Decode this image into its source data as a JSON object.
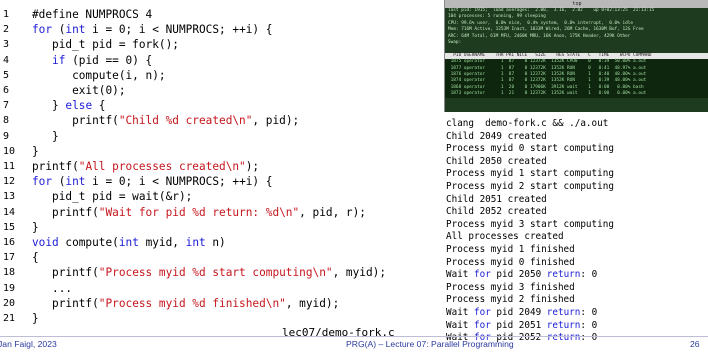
{
  "code": {
    "lines": [
      {
        "n": "1",
        "html": "#define NUMPROCS 4"
      },
      {
        "n": "2",
        "html": "<span class='kw'>for</span> (<span class='kw'>int</span> i = 0; i < NUMPROCS; ++i) {"
      },
      {
        "n": "3",
        "html": "   pid_t pid = fork();"
      },
      {
        "n": "4",
        "html": "   <span class='kw'>if</span> (pid == 0) {"
      },
      {
        "n": "5",
        "html": "      compute(i, n);"
      },
      {
        "n": "6",
        "html": "      exit(0);"
      },
      {
        "n": "7",
        "html": "   } <span class='kw'>else</span> {"
      },
      {
        "n": "8",
        "html": "      printf(<span class='str'>\"Child %d created\\n\"</span>, pid);"
      },
      {
        "n": "9",
        "html": "   }"
      },
      {
        "n": "10",
        "html": "}"
      },
      {
        "n": "11",
        "html": "printf(<span class='str'>\"All processes created\\n\"</span>);"
      },
      {
        "n": "12",
        "html": "<span class='kw'>for</span> (<span class='kw'>int</span> i = 0; i < NUMPROCS; ++i) {"
      },
      {
        "n": "13",
        "html": "   pid_t pid = wait(&r);"
      },
      {
        "n": "14",
        "html": "   printf(<span class='str'>\"Wait for pid %d return: %d\\n\"</span>, pid, r);"
      },
      {
        "n": "15",
        "html": "}"
      },
      {
        "n": "16",
        "html": "<span class='kw'>void</span> compute(<span class='kw'>int</span> myid, <span class='kw'>int</span> n)"
      },
      {
        "n": "17",
        "html": "{"
      },
      {
        "n": "18",
        "html": "   printf(<span class='str'>\"Process myid %d start computing\\n\"</span>, myid);"
      },
      {
        "n": "19",
        "html": "   ..."
      },
      {
        "n": "20",
        "html": "   printf(<span class='str'>\"Process myid %d finished\\n\"</span>, myid);"
      },
      {
        "n": "21",
        "html": "}"
      }
    ],
    "filename": "lec07/demo-fork.c"
  },
  "top_screenshot": {
    "titlebar": "top",
    "lines": [
      "last pid: 1915;  load averages:  2.00,  3.16,  2.02    up 0+02:13:25  21:13:15",
      "104 processes: 5 running, 99 sleeping",
      "CPU: 99.6% user,  0.0% nice,  0.4% system,  0.0% interrupt,  0.0% idle",
      "Mem: 716M Active, 1253M Inact, 1033M Wired, 26M Cache, 1630M Buf, 12G Free",
      "ARC: 64M Total, 61M MFU, 2460K MRU, 16K Anon, 175K Header, 429K Other",
      "Swap:",
      "",
      "  PID USERNAME    THR PRI NICE   SIZE    RES STATE   C   TIME    WCPU COMMAND",
      " 1875 operator      1  87    0 12372K  1352K CPU0    0   0:39  50.00% a.out",
      " 1877 operator      1  87    0 12372K  1352K RUN     0   0:41  48.97% a.out",
      " 1876 operator      1  87    0 12372K  1352K RUN     1   0:40  48.00% a.out",
      " 1874 operator      1  87    0 12372K  1352K RUN     1   0:39  48.00% a.out",
      " 1868 operator      1  20    0 17906K  3912K wait    1   0:00   0.00% bash",
      " 1873 operator      1  21    0 12372K  1352K wait    1   0:00   0.00% a.out"
    ]
  },
  "terminal": {
    "lines": [
      "clang  demo-fork.c && ./a.out",
      "Child 2049 created",
      "Process myid 0 start computing",
      "Child 2050 created",
      "Process myid 1 start computing",
      "Process myid 2 start computing",
      "Child 2051 created",
      "Child 2052 created",
      "Process myid 3 start computing",
      "All processes created",
      "Process myid 1 finished",
      "Process myid 0 finished",
      "Wait for pid 2050 return: 0",
      "Process myid 3 finished",
      "Process myid 2 finished",
      "Wait for pid 2049 return: 0",
      "Wait for pid 2051 return: 0",
      "Wait for pid 2052 return: 0"
    ],
    "keyword_words": [
      "for",
      "return"
    ]
  },
  "footer": {
    "author": "Jan Faigl, 2023",
    "title": "PRG(A) – Lecture 07: Parallel Programming",
    "page": "26"
  },
  "colors": {
    "keyword": "#1b1bd6",
    "string": "#c5161d",
    "footer_text": "#2b3a9e"
  }
}
